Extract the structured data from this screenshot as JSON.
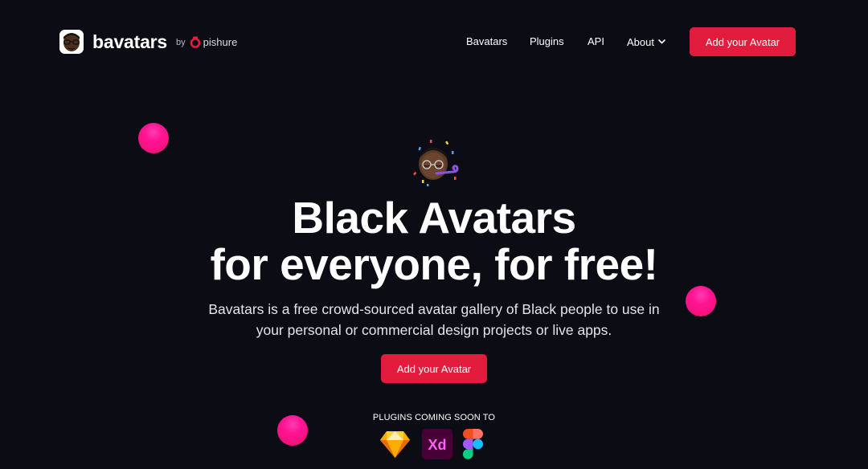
{
  "header": {
    "brand": "bavatars",
    "by": "by",
    "partner": "pishure",
    "nav": {
      "bavatars": "Bavatars",
      "plugins": "Plugins",
      "api": "API",
      "about": "About"
    },
    "cta": "Add your Avatar"
  },
  "hero": {
    "title_line1": "Black Avatars",
    "title_line2": "for everyone, for free!",
    "subtitle_line1": "Bavatars is a free crowd-sourced avatar gallery of Black people to use in",
    "subtitle_line2": "your personal or commercial design projects or live apps.",
    "cta": "Add your Avatar",
    "plugins_label": "PLUGINS COMING SOON TO",
    "plugins": [
      "sketch-icon",
      "adobe-xd-icon",
      "figma-icon"
    ],
    "plugins_xd_text": "Xd"
  },
  "colors": {
    "background": "#0c0c14",
    "accent": "#e31c3d",
    "dots": "#ff1493"
  }
}
